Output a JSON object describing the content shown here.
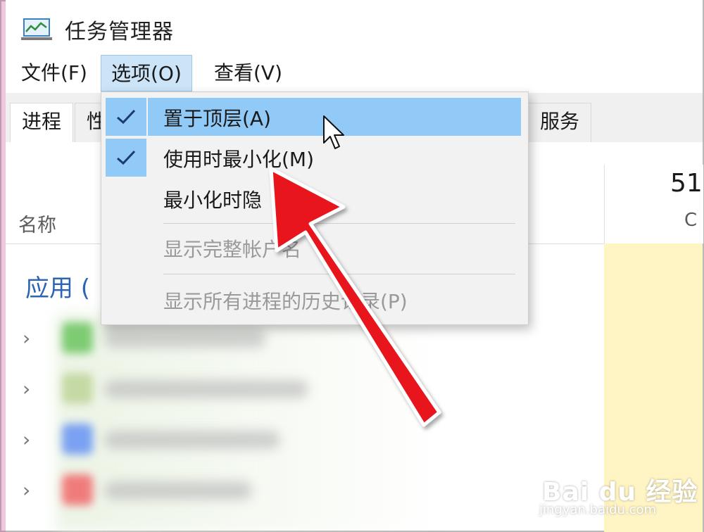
{
  "app": {
    "title": "任务管理器"
  },
  "menubar": {
    "items": [
      "文件(F)",
      "选项(O)",
      "查看(V)"
    ]
  },
  "tabs": [
    "进程",
    "性",
    "服务"
  ],
  "columns": {
    "name": "名称",
    "cpu_value": "51",
    "cpu_label": "C"
  },
  "group": {
    "apps_label": "应用 ("
  },
  "dropdown": {
    "items": [
      {
        "label": "置于顶层(A)",
        "checked": true,
        "state": "hover"
      },
      {
        "label": "使用时最小化(M)",
        "checked": true,
        "state": "normal"
      },
      {
        "label": "最小化时隐",
        "checked": false,
        "state": "normal"
      },
      {
        "label": "显示完整帐户名",
        "checked": false,
        "state": "disabled"
      },
      {
        "label": "显示所有进程的历史记录(P)",
        "checked": false,
        "state": "disabled"
      }
    ]
  },
  "watermark": {
    "brand": "Bai du 经验",
    "url": "jingyan.baidu.com"
  },
  "colors": {
    "accent": "#91c9f7",
    "group_text": "#2b64b7",
    "arrow": "#e8151f"
  }
}
